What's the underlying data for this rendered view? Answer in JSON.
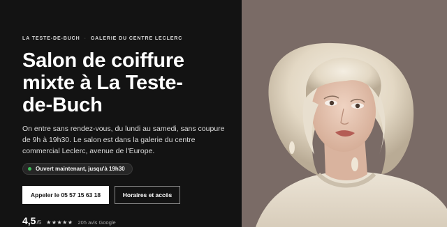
{
  "breadcrumb": {
    "location": "La Teste-de-Buch",
    "separator": "·",
    "venue": "Galerie du Centre Leclerc"
  },
  "hero": {
    "title": "Salon de coiffure mixte à La Teste-de-Buch",
    "description": "On entre sans rendez-vous, du lundi au samedi, sans coupure de 9h à 19h30. Le salon est dans la galerie du centre commercial Leclerc, avenue de l'Europe.",
    "status": "Ouvert maintenant, jusqu'à 19h30"
  },
  "actions": {
    "call_label": "Appeler le 05 57 15 63 18",
    "hours_label": "Horaires et accès"
  },
  "rating": {
    "score": "4,5",
    "out_of": "/5",
    "stars": "★★★★★",
    "reviews": "205 avis Google"
  },
  "colors": {
    "background": "#131313",
    "photo_bg": "#7a6b66",
    "status_dot": "#3fc05c",
    "primary_button": "#ffffff"
  }
}
